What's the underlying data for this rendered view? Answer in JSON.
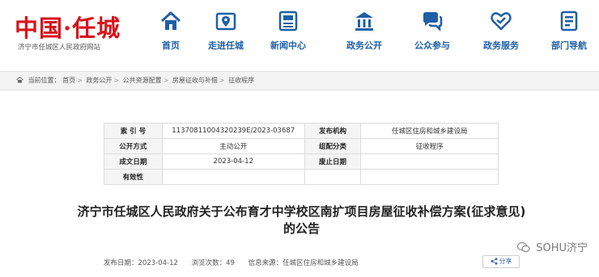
{
  "site": {
    "logo_text": "中国·任城",
    "subtitle": "济宁市任城区人民政府网站"
  },
  "nav": [
    {
      "label": "首页",
      "icon": "home-icon"
    },
    {
      "label": "走进任城",
      "icon": "map-pin-icon"
    },
    {
      "label": "新闻中心",
      "icon": "newspaper-icon"
    },
    {
      "label": "政务公开",
      "icon": "building-icon"
    },
    {
      "label": "公众参与",
      "icon": "chat-bubbles-icon"
    },
    {
      "label": "政务服务",
      "icon": "heart-hands-icon"
    },
    {
      "label": "部门导航",
      "icon": "document-list-icon"
    }
  ],
  "breadcrumb": {
    "prefix": "当前位置：",
    "items": [
      "首页",
      "政务公开",
      "公共资源配置",
      "房屋征收与补偿",
      "征收程序"
    ]
  },
  "info": {
    "index_label": "索 引 号",
    "index_value": "11370811004320239E/2023-03687",
    "publisher_label": "发布机构",
    "publisher_value": "任城区住房和城乡建设局",
    "method_label": "公开方式",
    "method_value": "主动公开",
    "category_label": "组配分类",
    "category_value": "征收程序",
    "date_label": "成文日期",
    "date_value": "2023-04-12",
    "expire_label": "废止日期",
    "expire_value": "",
    "valid_label": "有效性",
    "valid_value": ""
  },
  "article": {
    "title": "济宁市任城区人民政府关于公布育才中学校区南扩项目房屋征收补偿方案(征求意见)的公告",
    "publish_date": "发布日期：2023-04-12",
    "views": "浏览次数：49",
    "source": "信息来源：任城区住房和城乡建设局"
  },
  "watermark": "SOHU济宁",
  "share_label": "分享",
  "colors": {
    "brand_red": "#d8131a",
    "nav_blue": "#1f5fa6"
  }
}
